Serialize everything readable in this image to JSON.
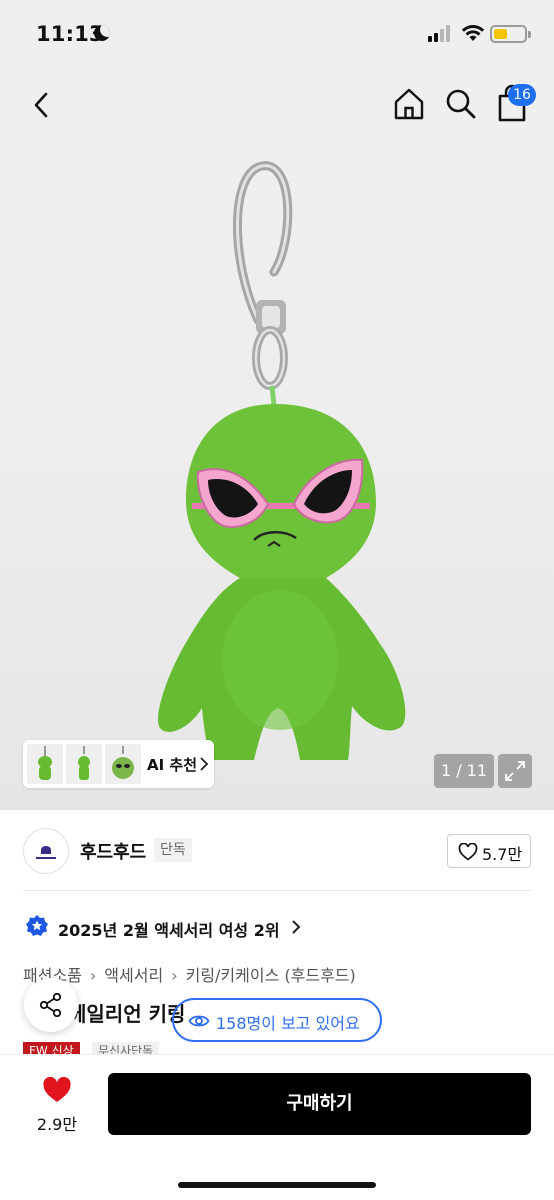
{
  "status_bar": {
    "time": "11:13",
    "battery_color": "#f2c500"
  },
  "header": {
    "back_icon": "chevron-left-icon",
    "home_icon": "home-icon",
    "search_icon": "search-icon",
    "cart_icon": "shopping-bag-icon",
    "cart_count": "16"
  },
  "gallery": {
    "ai_label": "AI 추천",
    "counter": "1 / 11",
    "expand_icon": "expand-icon"
  },
  "brand": {
    "name": "후드후드",
    "tag": "단독",
    "like_count": "5.7만"
  },
  "ranking": {
    "text": "2025년 2월 액세서리 여성 2위"
  },
  "breadcrumb": {
    "items": [
      "패션소품",
      "액세서리",
      "키링/키케이스 (후드후드)"
    ]
  },
  "product": {
    "title": "에일리언 키링",
    "viewing": "158명이 보고 있어요",
    "tag_exclusive": "FW 신상",
    "tag_store": "무신사단독"
  },
  "bottom": {
    "wish_count": "2.9만",
    "buy_label": "구매하기",
    "accent_color": "#2f6ef2",
    "heart_color": "#e0141c"
  }
}
